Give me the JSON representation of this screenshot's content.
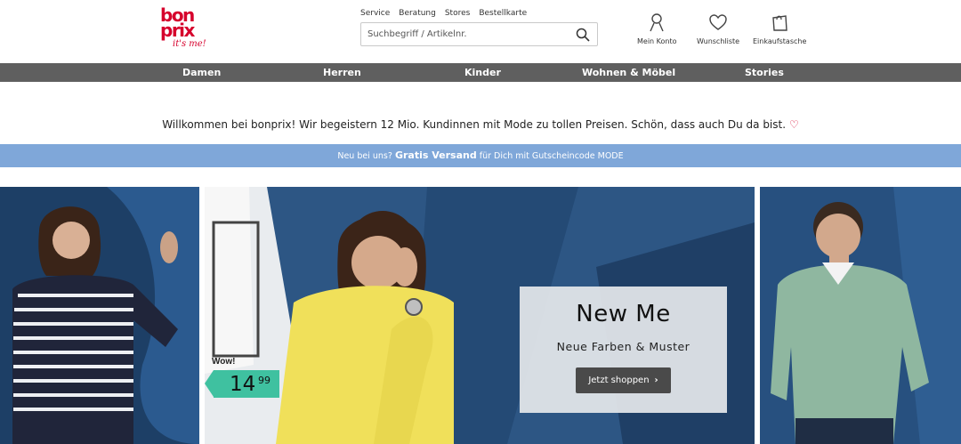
{
  "brand": {
    "logo_line1": "bon",
    "logo_line2": "prix",
    "logo_tagline": "it's me!",
    "color": "#d6002c"
  },
  "service_links": [
    "Service",
    "Beratung",
    "Stores",
    "Bestellkarte"
  ],
  "search": {
    "placeholder": "Suchbegriff / Artikelnr.",
    "value": ""
  },
  "header_icons": {
    "account": "Mein Konto",
    "wishlist": "Wunschliste",
    "bag": "Einkaufstasche"
  },
  "nav": [
    "Damen",
    "Herren",
    "Kinder",
    "Wohnen & Möbel",
    "Stories"
  ],
  "welcome": {
    "text": "Willkommen bei bonprix! Wir begeistern 12 Mio. Kundinnen mit Mode zu tollen Preisen. Schön, dass auch Du da bist.",
    "heart": "♡"
  },
  "promo": {
    "prefix": "Neu bei uns?",
    "highlight": "Gratis Versand",
    "suffix": "für Dich mit Gutscheincode MODE",
    "color": "#7fa7d9"
  },
  "hero": {
    "headline": "New Me",
    "subline": "Neue Farben & Muster",
    "cta": "Jetzt shoppen",
    "cta_chevron": "›",
    "badge_label": "Wow!",
    "price_euros": "14",
    "price_cents": "99",
    "price_color": "#3fc1a0"
  }
}
